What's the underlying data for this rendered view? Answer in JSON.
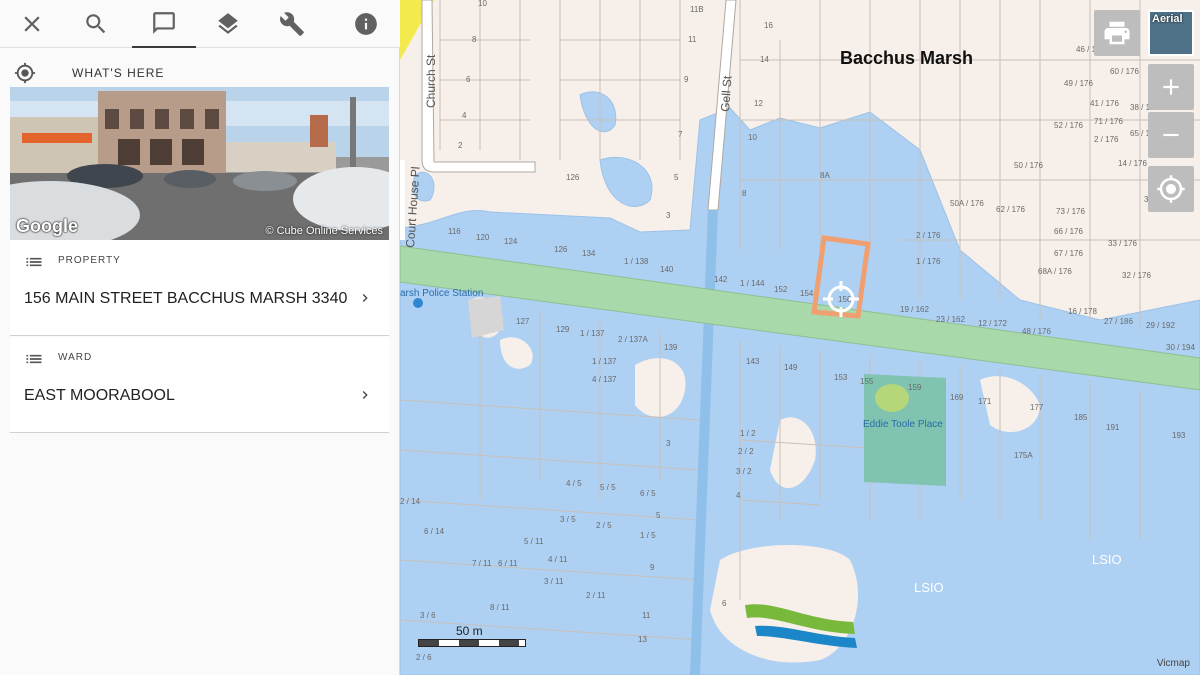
{
  "toolbar": {
    "items": [
      {
        "icon": "close-icon"
      },
      {
        "icon": "search-icon"
      },
      {
        "icon": "feedback-icon",
        "active": true
      },
      {
        "icon": "layers-icon"
      },
      {
        "icon": "wrench-icon"
      },
      {
        "icon": "info-icon"
      }
    ]
  },
  "panel": {
    "heading": "WHAT'S HERE",
    "streetview": {
      "brand": "Google",
      "credit": "© Cube Online Services"
    },
    "property": {
      "label": "PROPERTY",
      "value": "156 MAIN STREET BACCHUS MARSH 3340"
    },
    "ward": {
      "label": "WARD",
      "value": "EAST MOORABOOL"
    }
  },
  "map": {
    "town": "Bacchus Marsh",
    "streets": [
      "Church St",
      "Gell St",
      "Court House Pl"
    ],
    "places": [
      "arsh Police Station",
      "Eddie Toole Place"
    ],
    "overlay_labels": [
      "LSIO",
      "LSIO"
    ],
    "scale": "50 m",
    "attribution": "Vicmap",
    "aerial_label": "Aerial",
    "lots": [
      "10",
      "8",
      "6",
      "4",
      "2",
      "11B",
      "11",
      "9",
      "7",
      "5",
      "3",
      "16",
      "14",
      "12",
      "10",
      "8",
      "8A",
      "126",
      "116",
      "120",
      "124",
      "126",
      "134",
      "1/138",
      "140",
      "142",
      "1/144",
      "152",
      "154",
      "156",
      "2/176",
      "1/176",
      "19/162",
      "23/162",
      "12/172",
      "48/176",
      "16/178",
      "27/186",
      "29/192",
      "30/194",
      "127",
      "129",
      "1/137",
      "2/137A",
      "1/137",
      "4/137",
      "139",
      "143",
      "149",
      "153",
      "155",
      "159",
      "169",
      "171",
      "177",
      "185",
      "191",
      "193",
      "175A",
      "1/2",
      "2/2",
      "3/2",
      "4",
      "4/5",
      "5/5",
      "6/5",
      "3/5",
      "2/5",
      "1/5",
      "5",
      "9",
      "5/11",
      "6/11",
      "7/11",
      "3/11",
      "2/11",
      "8/11",
      "11",
      "13",
      "2/14",
      "6/14",
      "3/6",
      "2/6",
      "6",
      "46/176",
      "60/176",
      "49/176",
      "41/176",
      "38/176",
      "71/176",
      "2/176",
      "65/176",
      "52/176",
      "14/176",
      "50/176",
      "35/176",
      "50A/176",
      "62/176",
      "73/176",
      "66/176",
      "33/176",
      "67/176",
      "68A/176",
      "32/176"
    ],
    "colors": {
      "flood": "#aed0f3",
      "rail": "#a9d8aa",
      "park": "#7fc3b0",
      "land": "#f7efe9",
      "selection": "#f0a070"
    }
  }
}
